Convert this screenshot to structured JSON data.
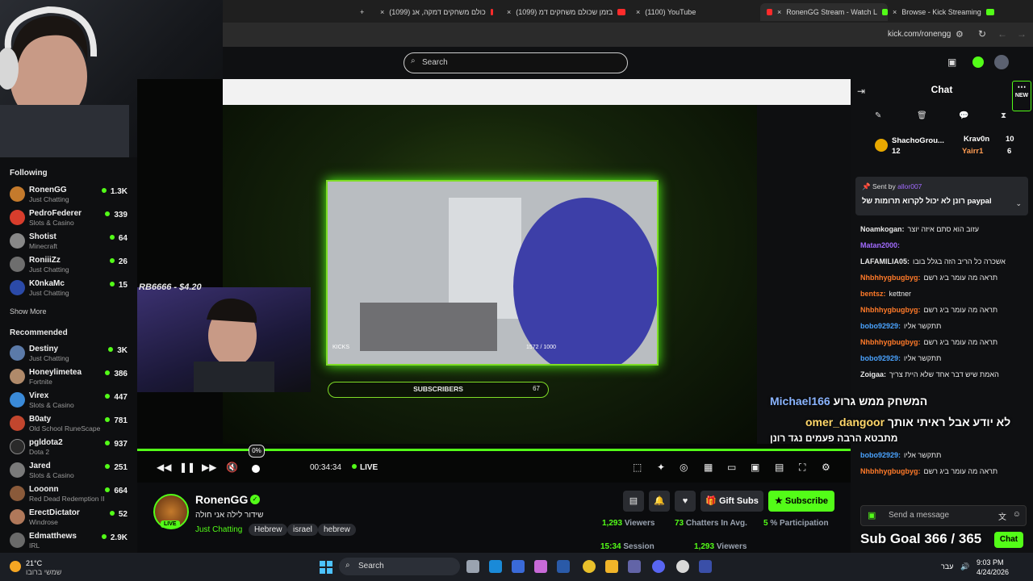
{
  "browser": {
    "tabs": [
      {
        "label": "(1099) כולם משחקים דמקה, אנ"
      },
      {
        "label": "(1099) בזמן שכולם משחקים דמ"
      },
      {
        "label": "(1100) YouTube"
      },
      {
        "label": "RonenGG Stream - Watch L"
      },
      {
        "label": "Browse - Kick Streaming"
      }
    ],
    "url": "kick.com/ronengg"
  },
  "sidebar": {
    "following_heading": "Following",
    "following": [
      {
        "name": "RonenGG",
        "category": "Just Chatting",
        "viewers": "1.3K"
      },
      {
        "name": "PedroFederer",
        "category": "Slots & Casino",
        "viewers": "339"
      },
      {
        "name": "Shotist",
        "category": "Minecraft",
        "viewers": "64"
      },
      {
        "name": "RoniiiZz",
        "category": "Just Chatting",
        "viewers": "26"
      },
      {
        "name": "K0nkaMc",
        "category": "Just Chatting",
        "viewers": "15"
      }
    ],
    "show_more": "Show More",
    "recommended_heading": "Recommended",
    "recommended": [
      {
        "name": "Destiny",
        "category": "Just Chatting",
        "viewers": "3K"
      },
      {
        "name": "Honeylimetea",
        "category": "Fortnite",
        "viewers": "386"
      },
      {
        "name": "Virex",
        "category": "Slots & Casino",
        "viewers": "447"
      },
      {
        "name": "B0aty",
        "category": "Old School RuneScape",
        "viewers": "781"
      },
      {
        "name": "pgldota2",
        "category": "Dota 2",
        "viewers": "937"
      },
      {
        "name": "Jared",
        "category": "Slots & Casino",
        "viewers": "251"
      },
      {
        "name": "Looonn",
        "category": "Red Dead Redemption II",
        "viewers": "664"
      },
      {
        "name": "ErectDictator",
        "category": "Windrose",
        "viewers": "52"
      },
      {
        "name": "Edmatthews",
        "category": "IRL",
        "viewers": "2.9K"
      }
    ]
  },
  "search": {
    "placeholder": "Search"
  },
  "player": {
    "donation_overlay": "RB6666 - $4.20",
    "subscribers_label": "SUBSCRIBERS",
    "subscribers_count": "67",
    "kicks_label": "KICKS",
    "kicks_count": "1572 / 1000",
    "time": "00:34:34",
    "live": "LIVE",
    "volume_tooltip": "0%",
    "progress": 1.0
  },
  "stream": {
    "channel": "RonenGG",
    "live_badge": "LIVE",
    "title": "שידור לילה אני חולה",
    "category": "Just Chatting",
    "tags": [
      "Hebrew",
      "israel",
      "hebrew"
    ],
    "gift_subs": "Gift Subs",
    "subscribe": "Subscribe",
    "viewers": "1,293",
    "viewers_label": "Viewers",
    "chatters": "73",
    "chatters_label": "Chatters In Avg.",
    "participation": "5",
    "participation_label": "% Participation",
    "session": "15:34",
    "session_label": "Session",
    "viewers2": "1,293",
    "viewers2_label": "Viewers"
  },
  "chat": {
    "heading": "Chat",
    "new_badge": "NEW",
    "gifters": [
      {
        "name": "ShachoGrou...",
        "count": "12"
      },
      {
        "name": "Krav0n",
        "count": "10"
      },
      {
        "name": "Yairr1",
        "count": "6"
      }
    ],
    "pinned_by_label": "Sent by",
    "pinned_by_user": "allor007",
    "pinned_message": "רונן לא יכול לקרוא תרומות של paypal",
    "messages": [
      {
        "user": "Noamkogan:",
        "text": "עזוב הוא סתם איזה יוצר",
        "color": "#e8e8e8"
      },
      {
        "user": "Matan2000:",
        "text": "",
        "color": "#a26bff"
      },
      {
        "user": "LAFAMILIA05:",
        "text": "אשכרה כל הריב הזה בגלל בובו",
        "color": "#e8e8e8"
      },
      {
        "user": "Nhbhhygbugbyg:",
        "text": "תראה מה עומר ביג רשם",
        "color": "#ff7a29"
      },
      {
        "user": "bentsz:",
        "text": "kettner",
        "color": "#ff7a29"
      },
      {
        "user": "Nhbhhygbugbyg:",
        "text": "תראה מה עומר ביג רשם",
        "color": "#ff7a29"
      },
      {
        "user": "bobo92929:",
        "text": "תתקשר אליו",
        "color": "#4aa3ff"
      },
      {
        "user": "Nhbhhygbugbyg:",
        "text": "תראה מה עומר ביג רשם",
        "color": "#ff7a29"
      },
      {
        "user": "bobo92929:",
        "text": "תתקשר אליו",
        "color": "#4aa3ff"
      },
      {
        "user": "Zoigaa:",
        "text": "האמת שיש דבר אחד שלא היית צריך",
        "color": "#e8e8e8"
      },
      {
        "user": "bobo92929:",
        "text": "תתקשר אליו",
        "color": "#4aa3ff"
      },
      {
        "user": "Nhbhhygbugbyg:",
        "text": "תראה מה עומר ביג רשם",
        "color": "#ff7a29"
      }
    ],
    "overlay1_user": "Michael166",
    "overlay1_text": "המשחק ממש גרוע",
    "overlay2_user": "omer_dangoor",
    "overlay2_text": "לא יודע אבל ראיתי אותך",
    "overlay3_text": "מתבטא הרבה פעמים נגד רונן",
    "send_placeholder": "Send a message",
    "chat_button": "Chat",
    "sub_goal": "Sub Goal 366 / 365"
  },
  "taskbar": {
    "temp": "21°C",
    "weather": "שמשי ברובו",
    "search": "Search",
    "lang": "עבר",
    "time": "9:03 PM",
    "date": "4/24/2026"
  },
  "colors": {
    "kick_green": "#53fc18",
    "bg": "#0b0c0e",
    "panel": "#0f1012"
  }
}
